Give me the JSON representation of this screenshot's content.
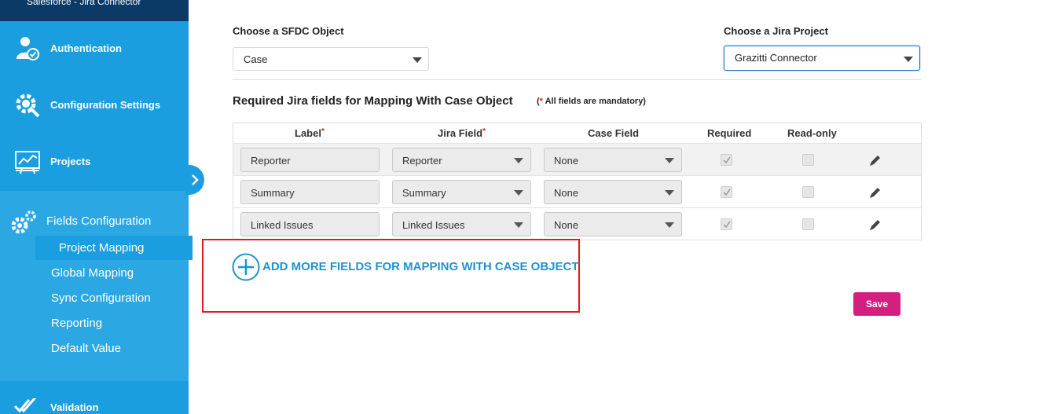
{
  "sidebar": {
    "brand": "Salesforce - Jira Connector",
    "nav": [
      {
        "label": "Authentication",
        "icon": "user-check-icon"
      },
      {
        "label": "Configuration Settings",
        "icon": "gear-wrench-icon"
      },
      {
        "label": "Projects",
        "icon": "presentation-chart-icon"
      }
    ],
    "fields_configuration": {
      "label": "Fields Configuration",
      "icon": "gears-icon",
      "items": [
        "Project Mapping",
        "Global Mapping",
        "Sync Configuration",
        "Reporting",
        "Default Value"
      ],
      "active": "Project Mapping"
    },
    "validation": {
      "label": "Validation",
      "icon": "double-check-icon"
    },
    "collapse_icon": "chevron-right-icon"
  },
  "main": {
    "sfdc_object": {
      "label": "Choose a SFDC Object",
      "value": "Case"
    },
    "jira_project": {
      "label": "Choose a Jira Project",
      "value": "Grazitti Connector"
    },
    "section_title": "Required Jira fields for Mapping With Case Object",
    "section_note_open": "(",
    "section_note_star": "*",
    "section_note_text": " All fields are mandatory)",
    "table": {
      "headers": {
        "label": "Label",
        "jira_field": "Jira Field",
        "case_field": "Case Field",
        "required": "Required",
        "read_only": "Read-only"
      },
      "required_marker": "*",
      "rows": [
        {
          "label": "Reporter",
          "jira_field": "Reporter",
          "case_field": "None",
          "required": true,
          "read_only": false
        },
        {
          "label": "Summary",
          "jira_field": "Summary",
          "case_field": "None",
          "required": true,
          "read_only": false
        },
        {
          "label": "Linked Issues",
          "jira_field": "Linked Issues",
          "case_field": "None",
          "required": true,
          "read_only": false
        }
      ]
    },
    "add_more_label": "ADD MORE FIELDS FOR MAPPING WITH CASE OBJECT",
    "save_label": "Save"
  },
  "colors": {
    "sidebar": "#1a9ee0",
    "sidebar_dark": "#0b3a66",
    "accent_link": "#1f92d1",
    "save_button": "#d31f7f",
    "highlight_box": "#e01b1b"
  }
}
